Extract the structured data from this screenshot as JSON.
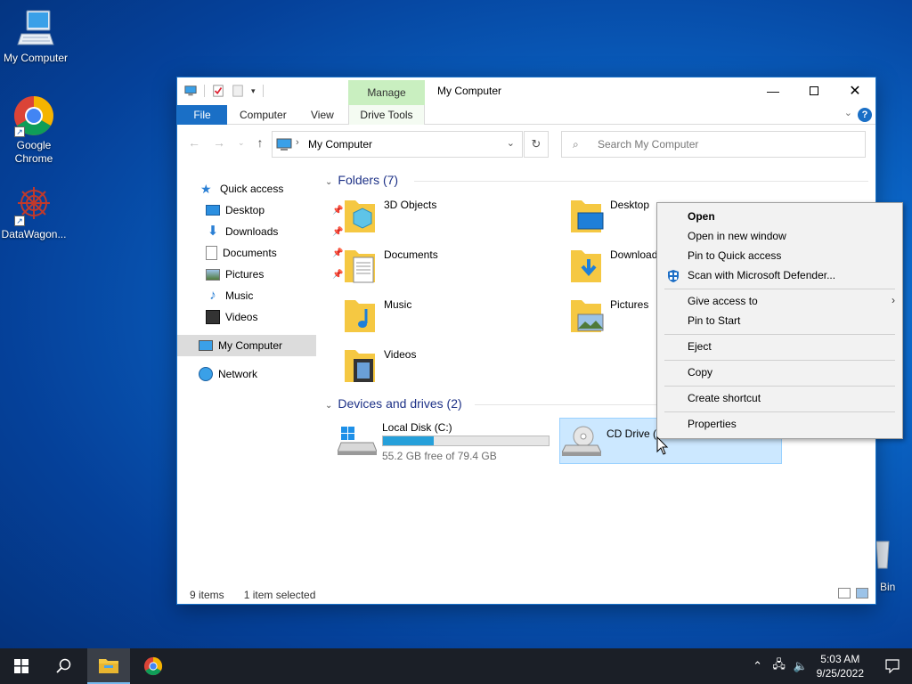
{
  "desktop": {
    "icons": [
      {
        "label": "My Computer"
      },
      {
        "label": "Google Chrome"
      },
      {
        "label": "DataWagon..."
      }
    ],
    "recycle_bin_label": "Bin"
  },
  "window": {
    "title": "My Computer",
    "manage_tab": "Manage",
    "ribbon": {
      "file": "File",
      "computer": "Computer",
      "view": "View",
      "drive_tools": "Drive Tools",
      "help": "?"
    },
    "address": {
      "location": "My Computer"
    },
    "search": {
      "placeholder": "Search My Computer"
    },
    "sidebar": {
      "quick_access": "Quick access",
      "items": [
        {
          "label": "Desktop"
        },
        {
          "label": "Downloads"
        },
        {
          "label": "Documents"
        },
        {
          "label": "Pictures"
        },
        {
          "label": "Music"
        },
        {
          "label": "Videos"
        }
      ],
      "this_pc": "My Computer",
      "network": "Network"
    },
    "folders_header": "Folders (7)",
    "folders": [
      {
        "name": "3D Objects"
      },
      {
        "name": "Desktop"
      },
      {
        "name": "Documents"
      },
      {
        "name": "Download"
      },
      {
        "name": "Music"
      },
      {
        "name": "Pictures"
      },
      {
        "name": "Videos"
      }
    ],
    "devices_header": "Devices and drives (2)",
    "drives": [
      {
        "name": "Local Disk (C:)",
        "free_text": "55.2 GB free of 79.4 GB",
        "used_fraction": 0.305
      },
      {
        "name": "CD Drive ("
      }
    ],
    "status": {
      "items": "9 items",
      "selected": "1 item selected"
    }
  },
  "context_menu": {
    "items": [
      {
        "label": "Open"
      },
      {
        "label": "Open in new window"
      },
      {
        "label": "Pin to Quick access"
      },
      {
        "label": "Scan with Microsoft Defender..."
      },
      {
        "label": "Give access to"
      },
      {
        "label": "Pin to Start"
      },
      {
        "label": "Eject"
      },
      {
        "label": "Copy"
      },
      {
        "label": "Create shortcut"
      },
      {
        "label": "Properties"
      }
    ]
  },
  "taskbar": {
    "time": "5:03 AM",
    "date": "9/25/2022"
  },
  "colors": {
    "accent": "#1a6fc6",
    "manage_tab": "#c9efc0",
    "selection": "#cce8ff",
    "drive_fill": "#26a0da"
  }
}
